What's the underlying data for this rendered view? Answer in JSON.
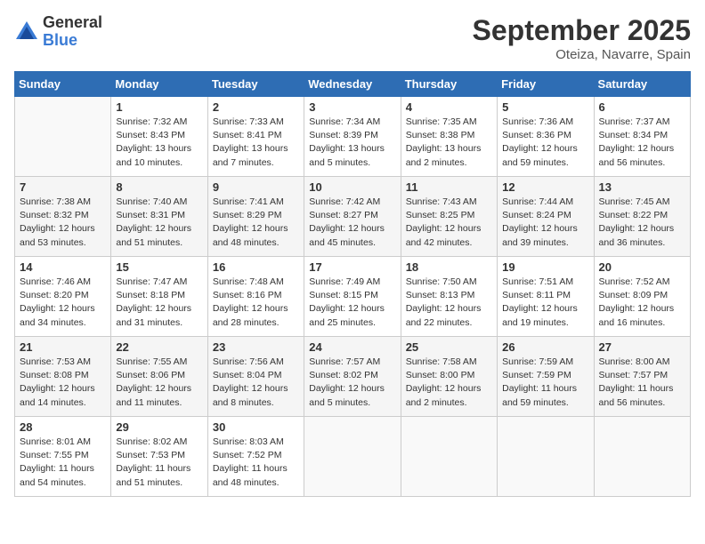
{
  "header": {
    "logo_line1": "General",
    "logo_line2": "Blue",
    "month_title": "September 2025",
    "location": "Oteiza, Navarre, Spain"
  },
  "days_of_week": [
    "Sunday",
    "Monday",
    "Tuesday",
    "Wednesday",
    "Thursday",
    "Friday",
    "Saturday"
  ],
  "weeks": [
    [
      {
        "day": "",
        "info": ""
      },
      {
        "day": "1",
        "info": "Sunrise: 7:32 AM\nSunset: 8:43 PM\nDaylight: 13 hours\nand 10 minutes."
      },
      {
        "day": "2",
        "info": "Sunrise: 7:33 AM\nSunset: 8:41 PM\nDaylight: 13 hours\nand 7 minutes."
      },
      {
        "day": "3",
        "info": "Sunrise: 7:34 AM\nSunset: 8:39 PM\nDaylight: 13 hours\nand 5 minutes."
      },
      {
        "day": "4",
        "info": "Sunrise: 7:35 AM\nSunset: 8:38 PM\nDaylight: 13 hours\nand 2 minutes."
      },
      {
        "day": "5",
        "info": "Sunrise: 7:36 AM\nSunset: 8:36 PM\nDaylight: 12 hours\nand 59 minutes."
      },
      {
        "day": "6",
        "info": "Sunrise: 7:37 AM\nSunset: 8:34 PM\nDaylight: 12 hours\nand 56 minutes."
      }
    ],
    [
      {
        "day": "7",
        "info": "Sunrise: 7:38 AM\nSunset: 8:32 PM\nDaylight: 12 hours\nand 53 minutes."
      },
      {
        "day": "8",
        "info": "Sunrise: 7:40 AM\nSunset: 8:31 PM\nDaylight: 12 hours\nand 51 minutes."
      },
      {
        "day": "9",
        "info": "Sunrise: 7:41 AM\nSunset: 8:29 PM\nDaylight: 12 hours\nand 48 minutes."
      },
      {
        "day": "10",
        "info": "Sunrise: 7:42 AM\nSunset: 8:27 PM\nDaylight: 12 hours\nand 45 minutes."
      },
      {
        "day": "11",
        "info": "Sunrise: 7:43 AM\nSunset: 8:25 PM\nDaylight: 12 hours\nand 42 minutes."
      },
      {
        "day": "12",
        "info": "Sunrise: 7:44 AM\nSunset: 8:24 PM\nDaylight: 12 hours\nand 39 minutes."
      },
      {
        "day": "13",
        "info": "Sunrise: 7:45 AM\nSunset: 8:22 PM\nDaylight: 12 hours\nand 36 minutes."
      }
    ],
    [
      {
        "day": "14",
        "info": "Sunrise: 7:46 AM\nSunset: 8:20 PM\nDaylight: 12 hours\nand 34 minutes."
      },
      {
        "day": "15",
        "info": "Sunrise: 7:47 AM\nSunset: 8:18 PM\nDaylight: 12 hours\nand 31 minutes."
      },
      {
        "day": "16",
        "info": "Sunrise: 7:48 AM\nSunset: 8:16 PM\nDaylight: 12 hours\nand 28 minutes."
      },
      {
        "day": "17",
        "info": "Sunrise: 7:49 AM\nSunset: 8:15 PM\nDaylight: 12 hours\nand 25 minutes."
      },
      {
        "day": "18",
        "info": "Sunrise: 7:50 AM\nSunset: 8:13 PM\nDaylight: 12 hours\nand 22 minutes."
      },
      {
        "day": "19",
        "info": "Sunrise: 7:51 AM\nSunset: 8:11 PM\nDaylight: 12 hours\nand 19 minutes."
      },
      {
        "day": "20",
        "info": "Sunrise: 7:52 AM\nSunset: 8:09 PM\nDaylight: 12 hours\nand 16 minutes."
      }
    ],
    [
      {
        "day": "21",
        "info": "Sunrise: 7:53 AM\nSunset: 8:08 PM\nDaylight: 12 hours\nand 14 minutes."
      },
      {
        "day": "22",
        "info": "Sunrise: 7:55 AM\nSunset: 8:06 PM\nDaylight: 12 hours\nand 11 minutes."
      },
      {
        "day": "23",
        "info": "Sunrise: 7:56 AM\nSunset: 8:04 PM\nDaylight: 12 hours\nand 8 minutes."
      },
      {
        "day": "24",
        "info": "Sunrise: 7:57 AM\nSunset: 8:02 PM\nDaylight: 12 hours\nand 5 minutes."
      },
      {
        "day": "25",
        "info": "Sunrise: 7:58 AM\nSunset: 8:00 PM\nDaylight: 12 hours\nand 2 minutes."
      },
      {
        "day": "26",
        "info": "Sunrise: 7:59 AM\nSunset: 7:59 PM\nDaylight: 11 hours\nand 59 minutes."
      },
      {
        "day": "27",
        "info": "Sunrise: 8:00 AM\nSunset: 7:57 PM\nDaylight: 11 hours\nand 56 minutes."
      }
    ],
    [
      {
        "day": "28",
        "info": "Sunrise: 8:01 AM\nSunset: 7:55 PM\nDaylight: 11 hours\nand 54 minutes."
      },
      {
        "day": "29",
        "info": "Sunrise: 8:02 AM\nSunset: 7:53 PM\nDaylight: 11 hours\nand 51 minutes."
      },
      {
        "day": "30",
        "info": "Sunrise: 8:03 AM\nSunset: 7:52 PM\nDaylight: 11 hours\nand 48 minutes."
      },
      {
        "day": "",
        "info": ""
      },
      {
        "day": "",
        "info": ""
      },
      {
        "day": "",
        "info": ""
      },
      {
        "day": "",
        "info": ""
      }
    ]
  ]
}
